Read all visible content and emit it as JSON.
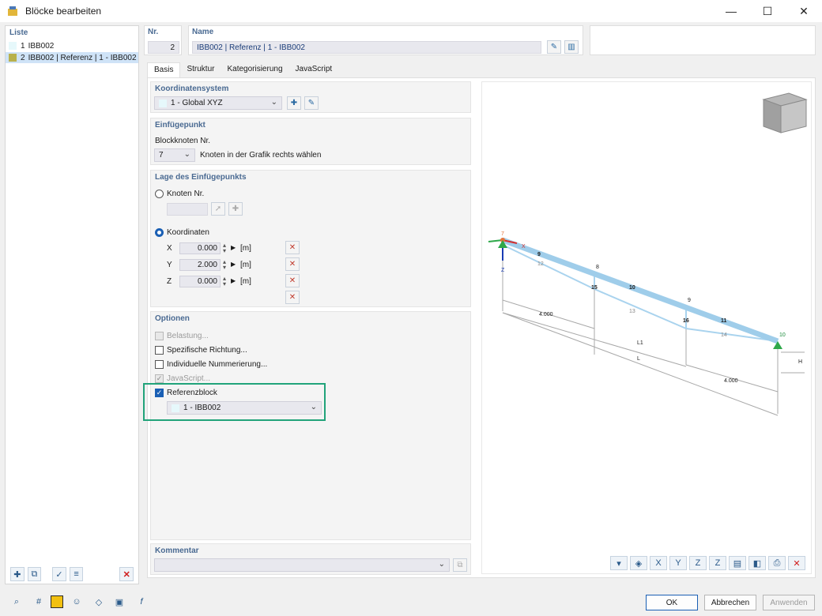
{
  "window": {
    "title": "Blöcke bearbeiten",
    "minimize": "—",
    "maximize": "☐",
    "close": "✕"
  },
  "list": {
    "label": "Liste",
    "items": [
      {
        "num": "1",
        "name": "IBB002",
        "color": "#e6f8fb"
      },
      {
        "num": "2",
        "name": "IBB002 | Referenz | 1 - IBB002",
        "color": "#b8b14c"
      }
    ]
  },
  "header": {
    "nr_label": "Nr.",
    "nr_value": "2",
    "name_label": "Name",
    "name_value": "IBB002 | Referenz | 1 - IBB002"
  },
  "tabs": [
    "Basis",
    "Struktur",
    "Kategorisierung",
    "JavaScript"
  ],
  "koordinatensystem": {
    "title": "Koordinatensystem",
    "value": "1 - Global XYZ"
  },
  "einfuegepunkt": {
    "title": "Einfügepunkt",
    "label": "Blockknoten Nr.",
    "value": "7",
    "hint": "Knoten in der Grafik rechts wählen"
  },
  "lage": {
    "title": "Lage des Einfügepunkts",
    "knoten_label": "Knoten Nr.",
    "koordinaten_label": "Koordinaten",
    "coords": [
      {
        "axis": "X",
        "value": "0.000",
        "unit": "[m]"
      },
      {
        "axis": "Y",
        "value": "2.000",
        "unit": "[m]"
      },
      {
        "axis": "Z",
        "value": "0.000",
        "unit": "[m]"
      }
    ]
  },
  "optionen": {
    "title": "Optionen",
    "items": [
      {
        "label": "Belastung...",
        "state": "disabled"
      },
      {
        "label": "Spezifische Richtung...",
        "state": "off"
      },
      {
        "label": "Individuelle Nummerierung...",
        "state": "off"
      },
      {
        "label": "JavaScript...",
        "state": "disabled-checked"
      },
      {
        "label": "Referenzblock",
        "state": "on"
      }
    ],
    "referenz_value": "1 - IBB002"
  },
  "kommentar": {
    "title": "Kommentar",
    "value": ""
  },
  "graphic": {
    "nodes": [
      "7",
      "8",
      "9",
      "10",
      "15",
      "16"
    ],
    "members": [
      "9",
      "10",
      "11",
      "12",
      "13",
      "14"
    ],
    "dims": [
      "4.000",
      "4.000",
      "L1",
      "L",
      "H"
    ],
    "axes": [
      "X",
      "Z"
    ]
  },
  "buttons": {
    "ok": "OK",
    "abbrechen": "Abbrechen",
    "anwenden": "Anwenden"
  },
  "colors": {
    "accent": "#1a5fb4",
    "highlight": "#21a37a",
    "member": "#9fcdea",
    "label": "#4a6a92"
  }
}
